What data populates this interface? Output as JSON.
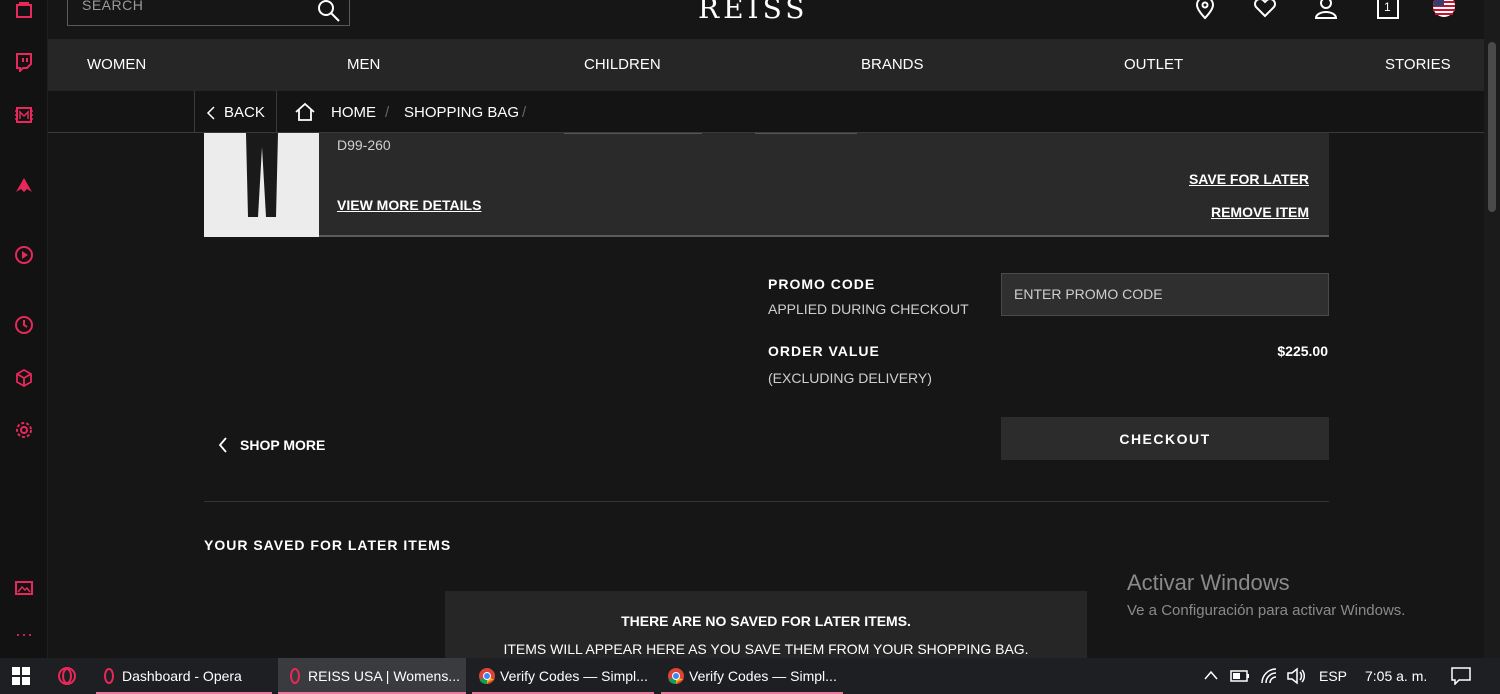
{
  "sidebar": {
    "icons": [
      "shopping-bag-icon",
      "twitch-icon",
      "mail-icon",
      "aria-icon",
      "player-icon",
      "history-icon",
      "cube-icon",
      "settings-icon",
      "gallery-icon",
      "more-icon"
    ],
    "accent": "#e8285a"
  },
  "header": {
    "search_placeholder": "SEARCH",
    "logo": "REISS",
    "bag_count": "1"
  },
  "nav": {
    "items": [
      "WOMEN",
      "MEN",
      "CHILDREN",
      "BRANDS",
      "OUTLET",
      "STORIES"
    ]
  },
  "breadcrumb": {
    "back": "BACK",
    "home": "HOME",
    "current": "SHOPPING BAG",
    "separator": "/"
  },
  "item": {
    "code": "D99-260",
    "view_details": "VIEW MORE DETAILS",
    "save_for_later": "SAVE FOR LATER",
    "remove": "REMOVE ITEM"
  },
  "summary": {
    "promo_label": "PROMO CODE",
    "promo_sub": "APPLIED DURING CHECKOUT",
    "promo_placeholder": "ENTER PROMO CODE",
    "order_label": "ORDER VALUE",
    "order_sub": "(EXCLUDING DELIVERY)",
    "order_value": "$225.00",
    "checkout": "CHECKOUT",
    "shop_more": "SHOP MORE"
  },
  "saved": {
    "title": "YOUR SAVED FOR LATER ITEMS",
    "empty_title": "THERE ARE NO SAVED FOR LATER ITEMS.",
    "empty_sub": "ITEMS WILL APPEAR HERE AS YOU SAVE THEM FROM YOUR SHOPPING BAG."
  },
  "watermark": {
    "title": "Activar Windows",
    "sub": "Ve a Configuración para activar Windows."
  },
  "taskbar": {
    "tasks": [
      "Dashboard - Opera",
      "REISS USA | Womens...",
      "Verify Codes — Simpl...",
      "Verify Codes — Simpl..."
    ],
    "lang": "ESP",
    "time": "7:05 a. m."
  }
}
